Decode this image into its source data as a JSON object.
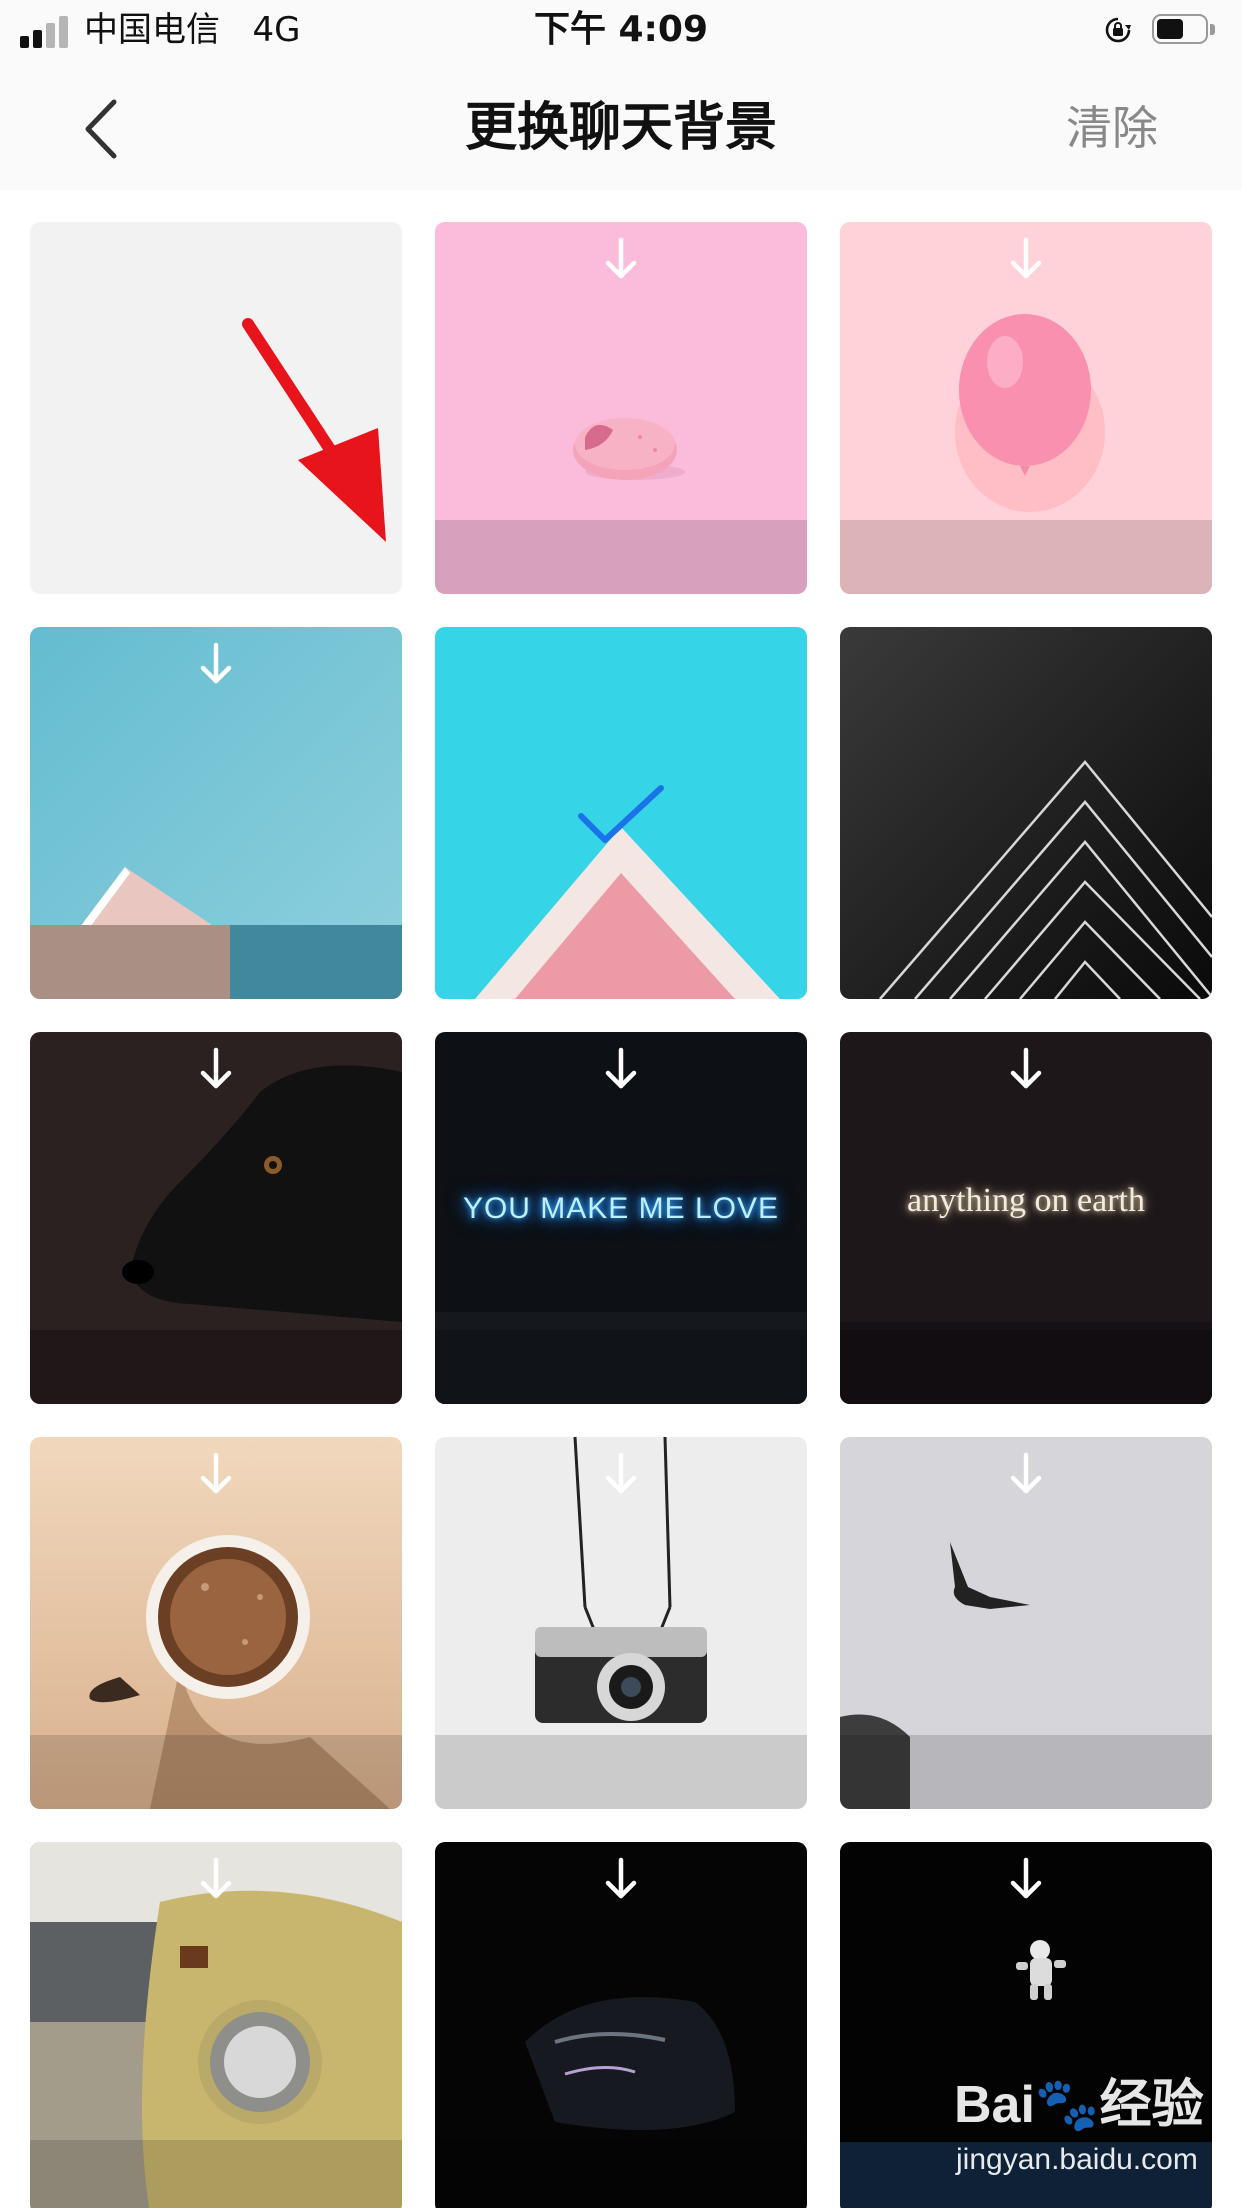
{
  "status_bar": {
    "carrier": "中国电信",
    "network": "4G",
    "time": "下午 4:09"
  },
  "nav": {
    "title": "更换聊天背景",
    "clear_label": "清除"
  },
  "wallpapers": [
    {
      "subject": "blank-light-gray",
      "download_available": false,
      "selected": false
    },
    {
      "subject": "macaron-on-pink",
      "download_available": true,
      "selected": false
    },
    {
      "subject": "pink-balloon",
      "download_available": true,
      "selected": false
    },
    {
      "subject": "roof-blue-sky",
      "download_available": true,
      "selected": false
    },
    {
      "subject": "pink-roof-cyan-sky",
      "download_available": false,
      "selected": true
    },
    {
      "subject": "dark-pyramid-lines",
      "download_available": false,
      "selected": false
    },
    {
      "subject": "black-dog",
      "download_available": true,
      "selected": false
    },
    {
      "subject": "neon-sign",
      "text": "YOU MAKE ME LOVE",
      "download_available": true,
      "selected": false
    },
    {
      "subject": "neon-sign",
      "text": "anything on earth",
      "download_available": true,
      "selected": false
    },
    {
      "subject": "coffee-cup",
      "download_available": true,
      "selected": false
    },
    {
      "subject": "hanging-camera",
      "download_available": true,
      "selected": false
    },
    {
      "subject": "seagull-gray-sky",
      "download_available": true,
      "selected": false
    },
    {
      "subject": "yellow-beetle-car",
      "download_available": true,
      "selected": false
    },
    {
      "subject": "dark-car",
      "download_available": true,
      "selected": false
    },
    {
      "subject": "astronaut-in-dark",
      "download_available": true,
      "selected": false
    }
  ],
  "watermark": {
    "logo": "Bai🐾经验",
    "url": "jingyan.baidu.com"
  },
  "colors": {
    "nav_background": "#fafafa",
    "clear_text": "#888888",
    "selected_check": "#1a73e8",
    "annotation_arrow": "#e8141c"
  }
}
